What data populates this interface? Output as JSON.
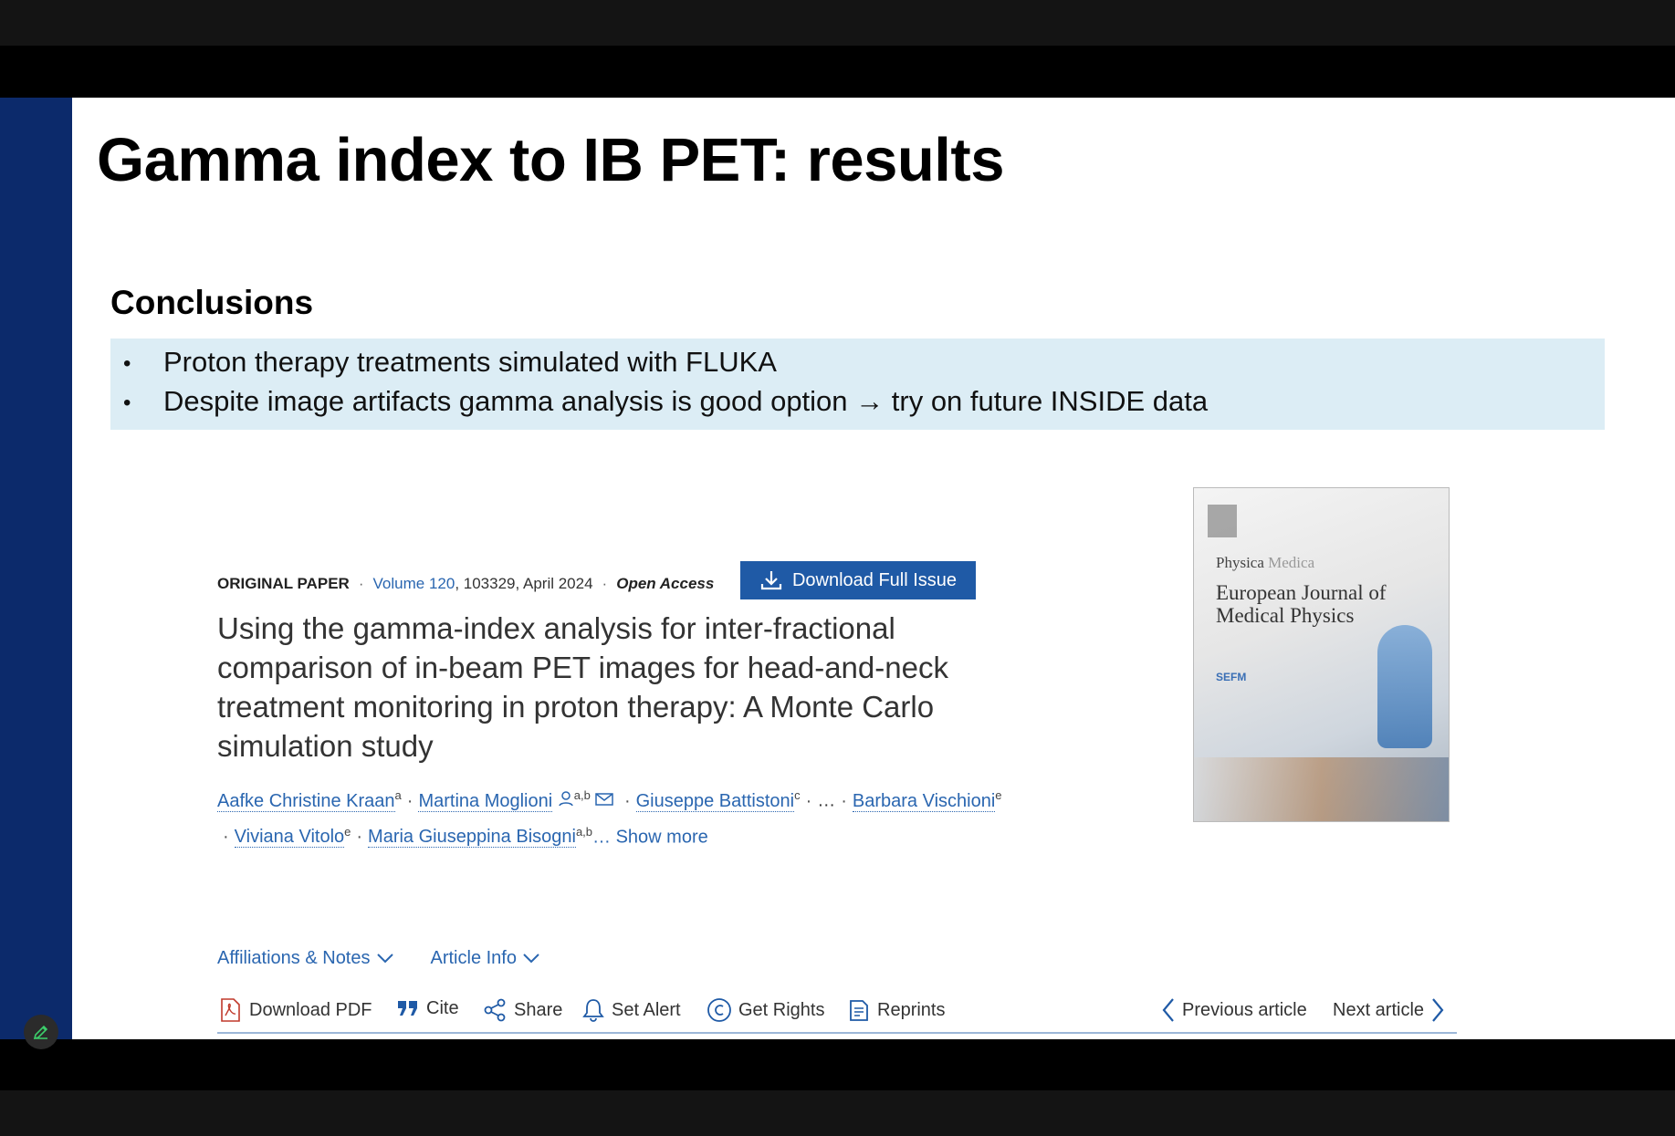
{
  "slide": {
    "title": "Gamma index to IB PET: results",
    "conclusions_heading": "Conclusions",
    "bullets": [
      "Proton therapy treatments simulated with FLUKA",
      "Despite image artifacts gamma analysis is good option → try on future INSIDE data"
    ]
  },
  "article": {
    "type": "ORIGINAL PAPER",
    "volume": "Volume 120",
    "ref": ", 103329, April 2024",
    "access": "Open Access",
    "download_issue_label": "Download Full Issue",
    "title": "Using the gamma-index analysis for inter-fractional comparison of in-beam PET images for head-and-neck treatment monitoring in proton therapy: A Monte Carlo simulation study",
    "authors": [
      {
        "name": "Aafke Christine Kraan",
        "sup": "a"
      },
      {
        "name": "Martina Moglioni",
        "sup": "a,b"
      },
      {
        "name": "Giuseppe Battistoni",
        "sup": "c"
      },
      {
        "name": "Barbara Vischioni",
        "sup": "e"
      },
      {
        "name": "Viviana Vitolo",
        "sup": "e"
      },
      {
        "name": "Maria Giuseppina Bisogni",
        "sup": "a,b"
      }
    ],
    "ellipsis": "…",
    "show_more": "… Show more",
    "affiliations_label": "Affiliations & Notes",
    "article_info_label": "Article Info",
    "toolbar": {
      "download_pdf": "Download PDF",
      "cite": "Cite",
      "share": "Share",
      "set_alert": "Set Alert",
      "get_rights": "Get Rights",
      "reprints": "Reprints",
      "previous_article": "Previous article",
      "next_article": "Next article"
    },
    "colors": {
      "link": "#2a66b0",
      "button": "#1f5aa6",
      "highlight": "#dcedf5",
      "sidebar": "#0c2a6b"
    }
  },
  "cover": {
    "line1": "Physica",
    "line1b": "Medica",
    "line2": "European Journal of Medical Physics",
    "assoc": "SEFM"
  }
}
